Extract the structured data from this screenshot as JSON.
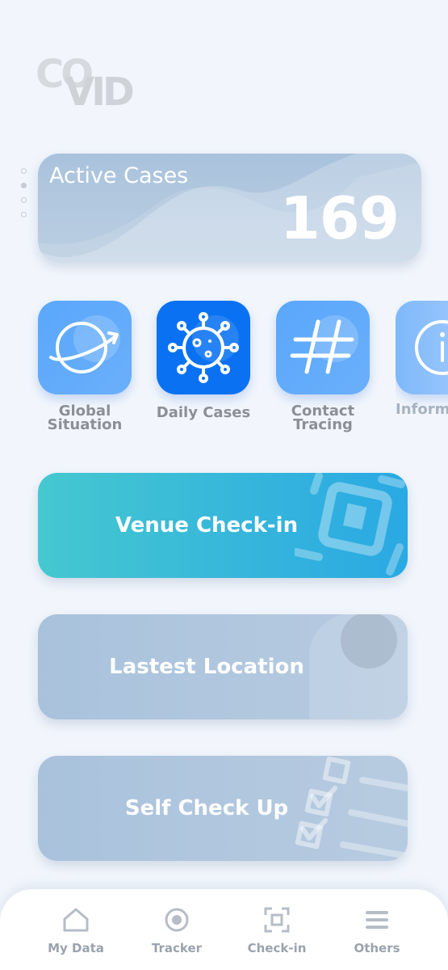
{
  "logo": {
    "line1": "CO",
    "line2": "VID"
  },
  "carousel": {
    "pages": 4,
    "active_index": 1
  },
  "active_cases": {
    "label": "Active Cases",
    "value": "169"
  },
  "categories": [
    {
      "label": "Global\nSituation",
      "icon": "globe-icon",
      "color": "#5aa7fb"
    },
    {
      "label": "Daily Cases",
      "icon": "virus-icon",
      "color": "#0a72f2"
    },
    {
      "label": "Contact\nTracing",
      "icon": "hashtag-icon",
      "color": "#5aa7fb"
    },
    {
      "label": "Inform",
      "icon": "info-icon",
      "color": "#8ec2fb"
    }
  ],
  "actions": {
    "venue": {
      "label": "Venue Check-in",
      "icon": "qr-scan-icon"
    },
    "latest": {
      "label": "Lastest Location",
      "icon": "location-pin-icon"
    },
    "selfcheck": {
      "label": "Self Check Up",
      "icon": "checklist-icon"
    }
  },
  "tabs": [
    {
      "label": "My Data",
      "icon": "home-icon"
    },
    {
      "label": "Tracker",
      "icon": "target-icon"
    },
    {
      "label": "Check-in",
      "icon": "scan-icon"
    },
    {
      "label": "Others",
      "icon": "menu-icon"
    }
  ]
}
